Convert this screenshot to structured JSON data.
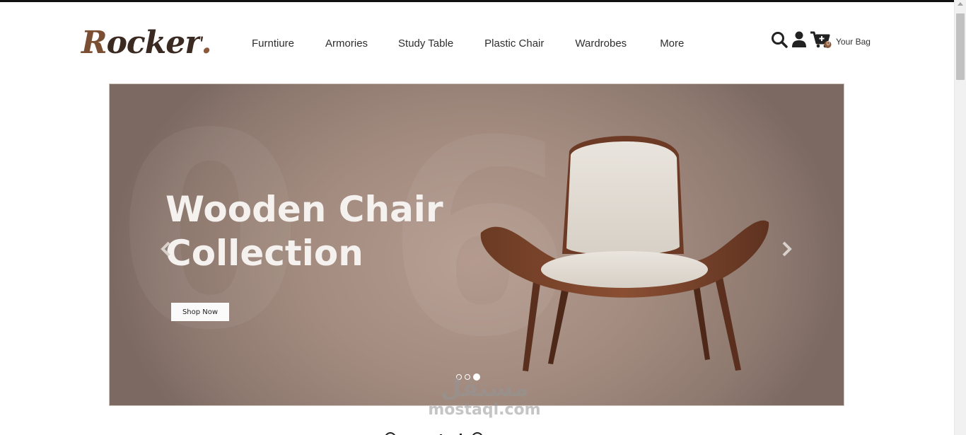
{
  "brand": {
    "logo_text": "Rocker",
    "logo_first": "R",
    "logo_rest": "ocker",
    "logo_dot": ".",
    "brand_color": "#7a4f33"
  },
  "nav": {
    "items": [
      {
        "label": "Furntiure"
      },
      {
        "label": "Armories"
      },
      {
        "label": "Study Table"
      },
      {
        "label": "Plastic Chair"
      },
      {
        "label": "Wardrobes"
      },
      {
        "label": "More"
      }
    ]
  },
  "header_icons": {
    "search": "search-icon",
    "user": "user-icon",
    "cart": "cart-icon",
    "bag_label": "Your Bag",
    "cart_count": "0"
  },
  "hero": {
    "title_line1": "Wooden Chair",
    "title_line2": "Collection",
    "button_label": "Shop Now",
    "slides_total": 3,
    "active_slide": 3,
    "prev_icon": "chevron-left-icon",
    "next_icon": "chevron-right-icon"
  },
  "watermark": {
    "arabic": "مستقل",
    "latin": "mostaql.com"
  }
}
